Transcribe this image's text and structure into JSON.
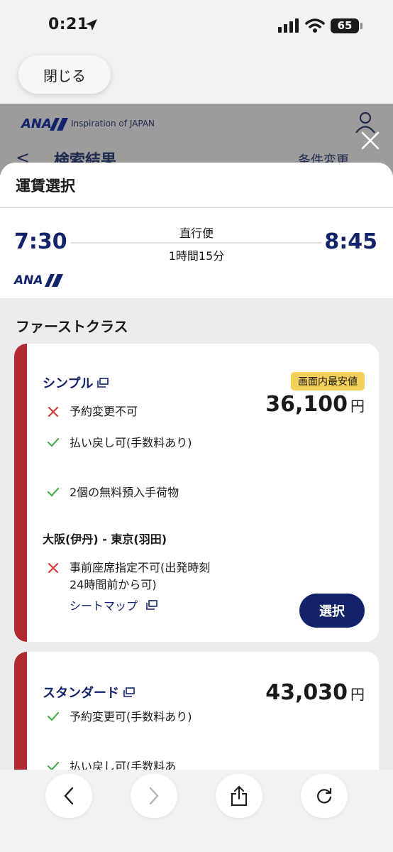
{
  "status_bar": {
    "time": "0:21",
    "battery": "65"
  },
  "close_button": "閉じる",
  "background_page": {
    "logo": "ANA",
    "tagline": "Inspiration of JAPAN",
    "back": "<",
    "title": "検索結果",
    "condition_change": "条件変更"
  },
  "sheet": {
    "title": "運賃選択",
    "flight": {
      "departure": "7:30",
      "arrival": "8:45",
      "type": "直行便",
      "duration": "1時間15分",
      "airline_logo": "ANA"
    },
    "class_title": "ファーストクラス",
    "fares": [
      {
        "name": "シンプル",
        "badge": "画面内最安値",
        "price": "36,100",
        "currency": "円",
        "features": [
          {
            "status": "no",
            "text": "予約変更不可"
          },
          {
            "status": "yes",
            "text": "払い戻し可(手数料あり)"
          },
          {
            "status": "yes",
            "text": "2個の無料預入手荷物"
          }
        ],
        "route": "大阪(伊丹)  -  東京(羽田)",
        "seat_feature": {
          "status": "no",
          "text": "事前座席指定不可(出発時刻24時間前から可)"
        },
        "seat_map_link": "シートマップ",
        "select_label": "選択"
      },
      {
        "name": "スタンダード",
        "price": "43,030",
        "currency": "円",
        "features": [
          {
            "status": "yes",
            "text": "予約変更可(手数料あり)"
          },
          {
            "status": "yes",
            "text": "払い戻し可(手数料あ"
          }
        ]
      }
    ]
  },
  "colors": {
    "navy": "#12236b",
    "accent_red": "#b02a30",
    "badge_yellow": "#f4cf5a",
    "check_green": "#4caf50",
    "cross_red": "#d23c3c"
  },
  "icons": [
    "location-arrow-icon",
    "signal-icon",
    "wifi-icon",
    "user-icon",
    "close-icon",
    "external-link-icon",
    "check-icon",
    "cross-icon",
    "back-icon",
    "forward-icon",
    "share-icon",
    "reload-icon"
  ]
}
